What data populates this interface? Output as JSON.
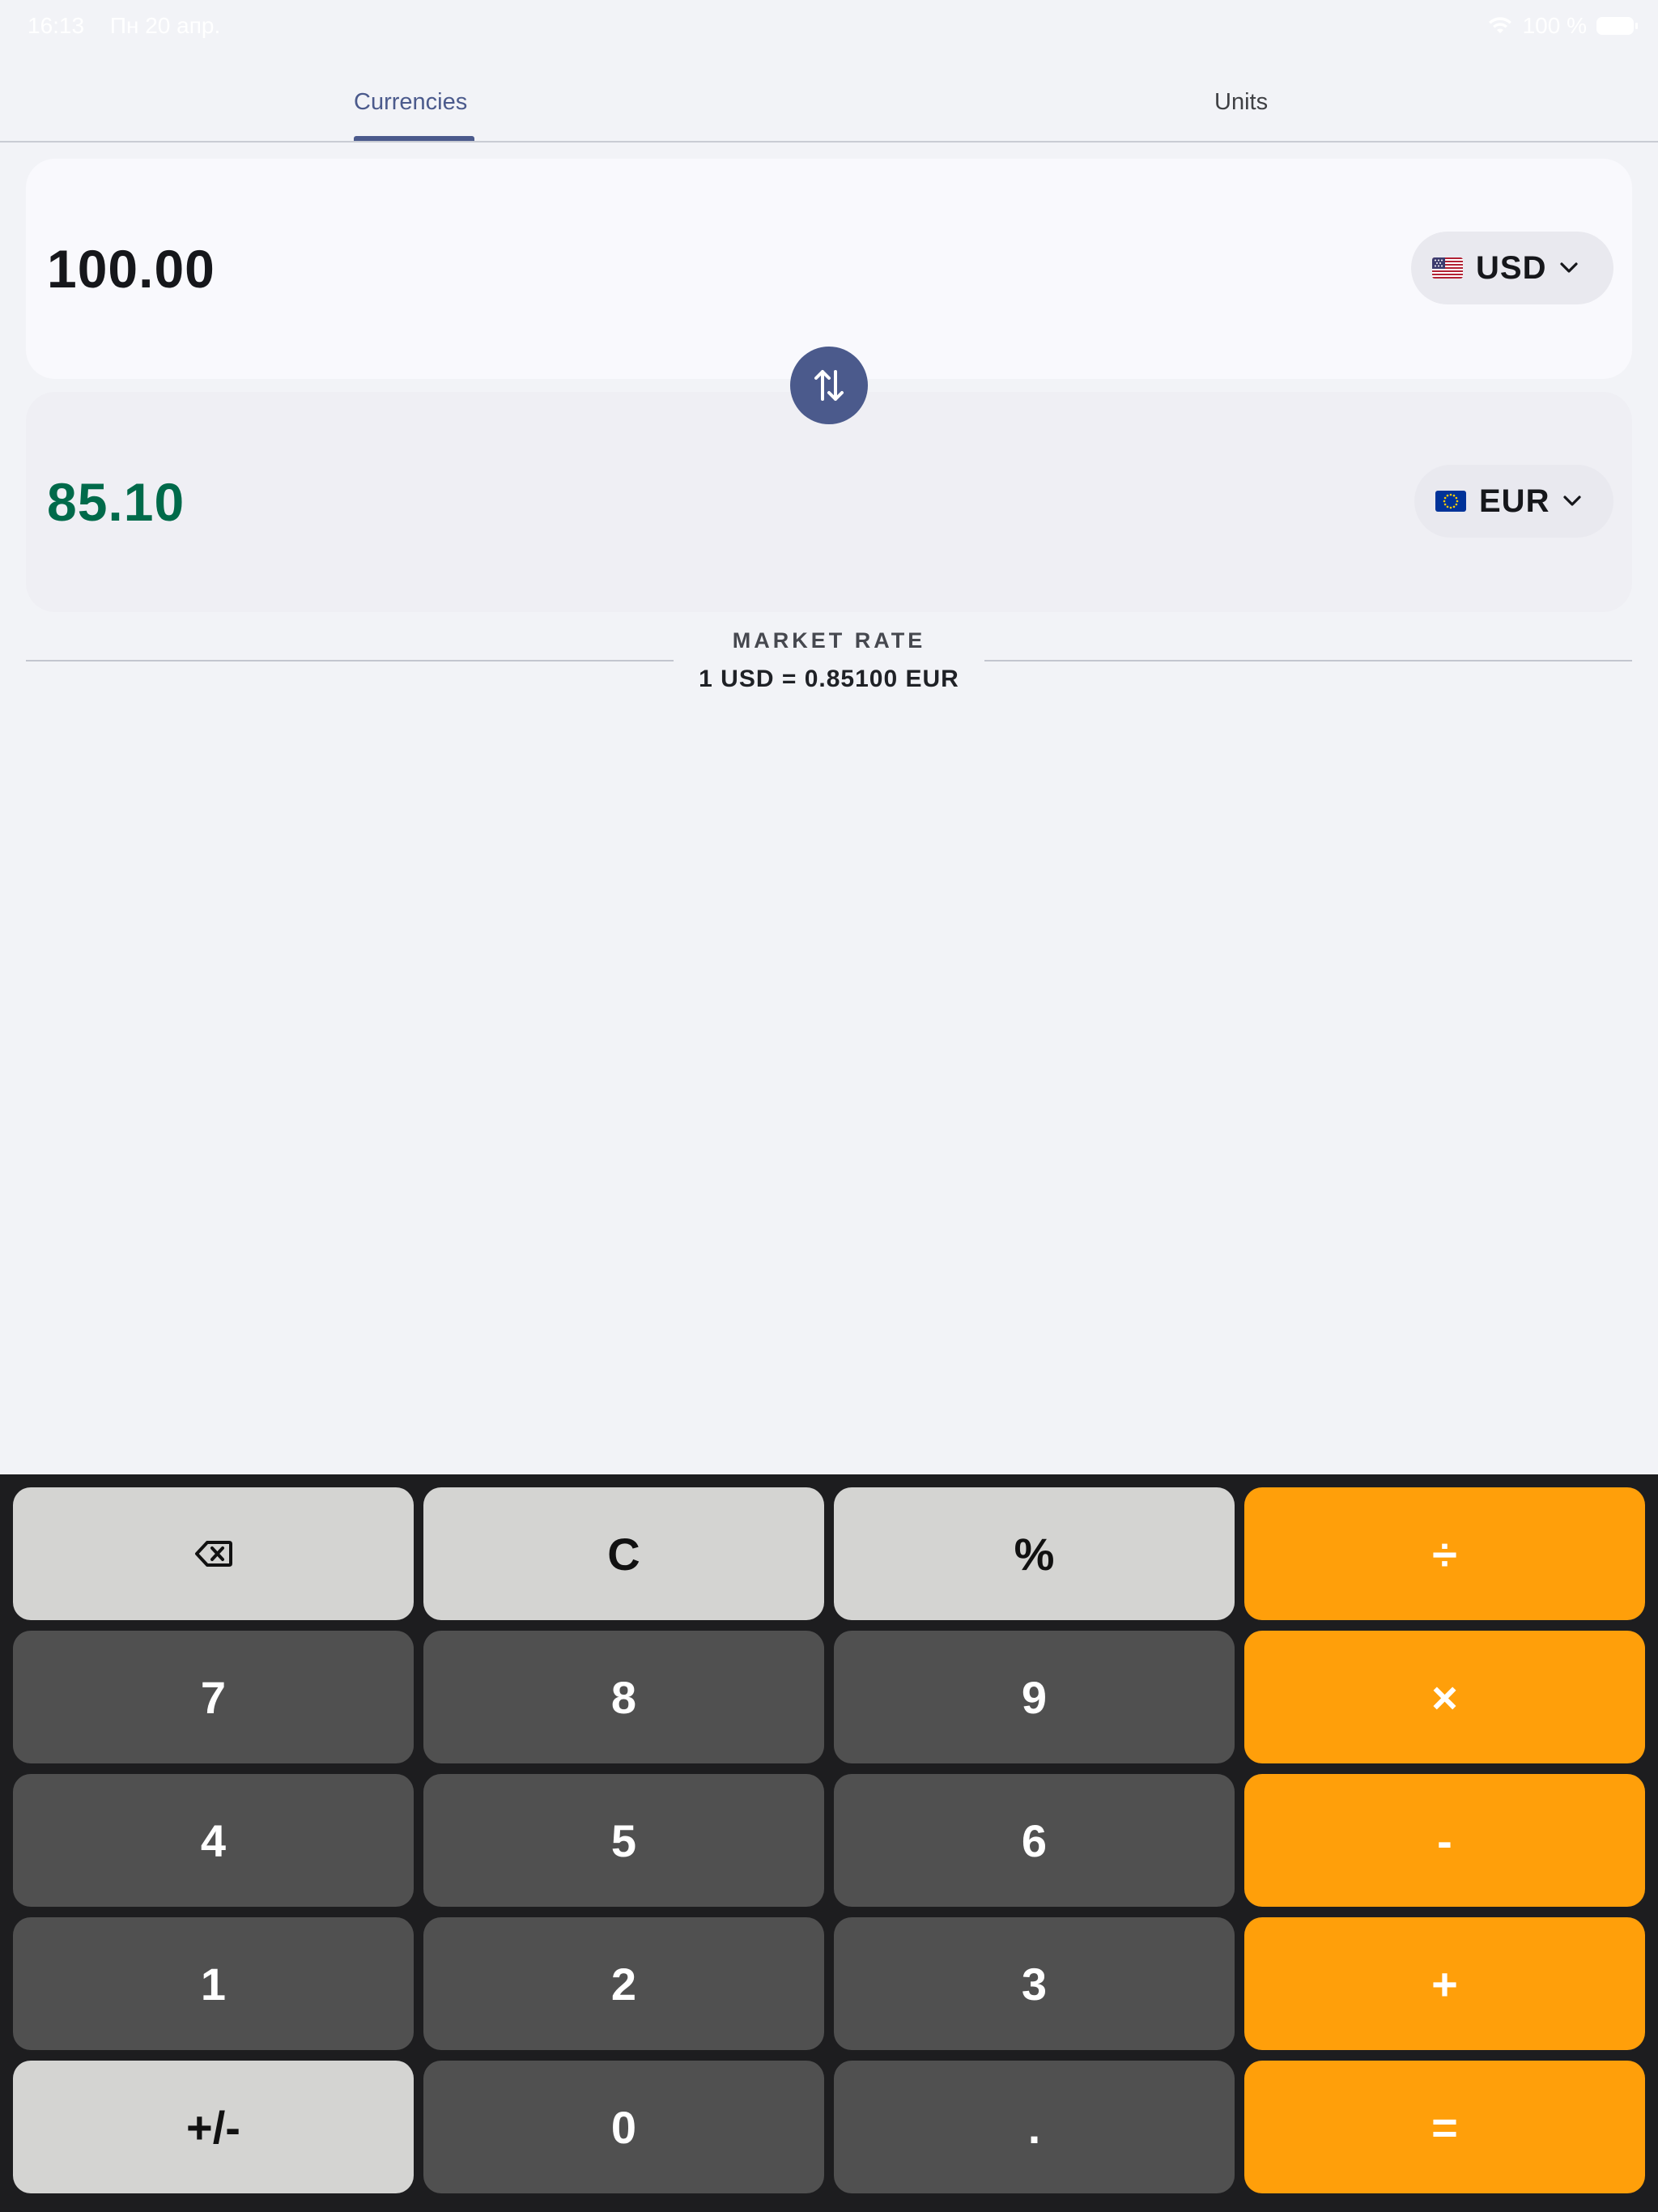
{
  "status_bar": {
    "time": "16:13",
    "date": "Пн 20 апр.",
    "battery": "100 %"
  },
  "tabs": [
    {
      "label": "Currencies",
      "active": true
    },
    {
      "label": "Units",
      "active": false
    }
  ],
  "converter": {
    "from": {
      "amount": "100.00",
      "currency": "USD",
      "flag": "us-flag-icon"
    },
    "to": {
      "amount": "85.10",
      "currency": "EUR",
      "flag": "eu-flag-icon"
    }
  },
  "market_rate": {
    "label": "MARKET RATE",
    "value": "1 USD = 0.85100 EUR"
  },
  "keypad": {
    "rows": [
      [
        "⌫",
        "C",
        "%",
        "÷"
      ],
      [
        "7",
        "8",
        "9",
        "×"
      ],
      [
        "4",
        "5",
        "6",
        "-"
      ],
      [
        "1",
        "2",
        "3",
        "+"
      ],
      [
        "+/-",
        "0",
        ".",
        "="
      ]
    ]
  },
  "colors": {
    "accent": "#4b5a8c",
    "result_green": "#006a4a",
    "operator_orange": "#ff9f0a",
    "key_dark": "#505050",
    "key_light": "#d4d4d2",
    "keypad_bg": "#1d1d1f",
    "background": "#f2f3f7"
  }
}
